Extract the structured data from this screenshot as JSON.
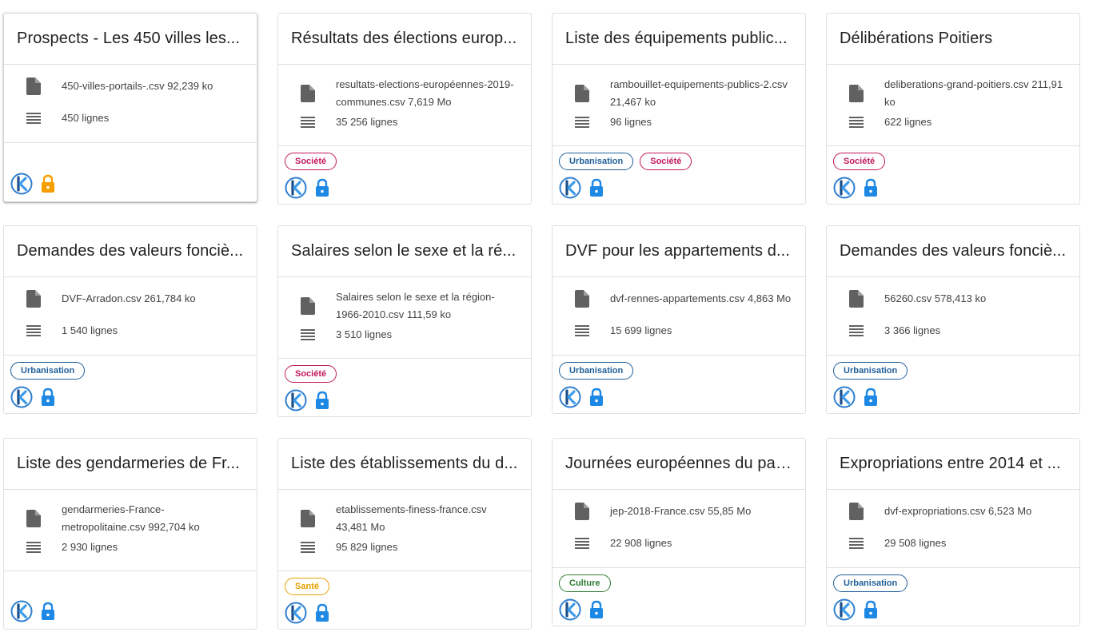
{
  "colors": {
    "border": "#e0e0e0",
    "file_icon": "#616161",
    "lock_blue": "#1e88e5",
    "lock_orange": "#f5a000",
    "logo_blue": "#1976d2"
  },
  "tag_colors": {
    "Société": "#c2185b",
    "Urbanisation": "#1f5f99",
    "Santé": "#e6a100",
    "Culture": "#2e7d32"
  },
  "cards": [
    {
      "title": "Prospects - Les 450 villes les...",
      "file": "450-villes-portails-.csv 92,239 ko",
      "rows": "450 lignes",
      "tags": [],
      "lock": "orange",
      "icons": [
        "file-icon",
        "list-icon",
        "k-logo-icon",
        "lock-icon"
      ]
    },
    {
      "title": "Résultats des élections europ...",
      "file": "resultats-elections-européennes-2019-communes.csv 7,619 Mo",
      "rows": "35 256 lignes",
      "tags": [
        "Société"
      ],
      "lock": "blue"
    },
    {
      "title": "Liste des équipements public...",
      "file": "rambouillet-equipements-publics-2.csv 21,467 ko",
      "rows": "96 lignes",
      "tags": [
        "Urbanisation",
        "Société"
      ],
      "lock": "blue"
    },
    {
      "title": "Délibérations Poitiers",
      "file": "deliberations-grand-poitiers.csv 211,91 ko",
      "rows": "622 lignes",
      "tags": [
        "Société"
      ],
      "lock": "blue"
    },
    {
      "title": "Demandes des valeurs fonciè...",
      "file": "DVF-Arradon.csv 261,784 ko",
      "rows": "1 540 lignes",
      "tags": [
        "Urbanisation"
      ],
      "lock": "blue"
    },
    {
      "title": "Salaires selon le sexe et la ré...",
      "file": "Salaires selon le sexe et la région-1966-2010.csv 111,59 ko",
      "rows": "3 510 lignes",
      "tags": [
        "Société"
      ],
      "lock": "blue"
    },
    {
      "title": "DVF pour les appartements d...",
      "file": "dvf-rennes-appartements.csv 4,863 Mo",
      "rows": "15 699 lignes",
      "tags": [
        "Urbanisation"
      ],
      "lock": "blue"
    },
    {
      "title": "Demandes des valeurs fonciè...",
      "file": "56260.csv 578,413 ko",
      "rows": "3 366 lignes",
      "tags": [
        "Urbanisation"
      ],
      "lock": "blue"
    },
    {
      "title": "Liste des gendarmeries de Fr...",
      "file": "gendarmeries-France-metropolitaine.csv 992,704 ko",
      "rows": "2 930 lignes",
      "tags": [],
      "lock": "blue"
    },
    {
      "title": "Liste des établissements du d...",
      "file": "etablissements-finess-france.csv 43,481 Mo",
      "rows": "95 829 lignes",
      "tags": [
        "Santé"
      ],
      "lock": "blue"
    },
    {
      "title": "Journées européennes du pat...",
      "file": "jep-2018-France.csv 55,85 Mo",
      "rows": "22 908 lignes",
      "tags": [
        "Culture"
      ],
      "lock": "blue"
    },
    {
      "title": "Expropriations entre 2014 et ...",
      "file": "dvf-expropriations.csv 6,523 Mo",
      "rows": "29 508 lignes",
      "tags": [
        "Urbanisation"
      ],
      "lock": "blue"
    }
  ]
}
